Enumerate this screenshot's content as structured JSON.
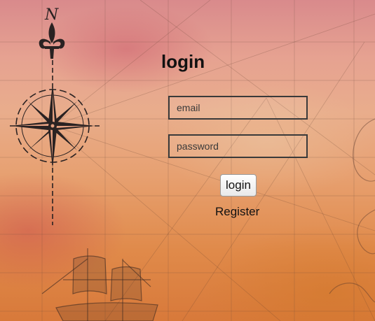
{
  "login_form": {
    "title": "login",
    "email_placeholder": "email",
    "password_placeholder": "password",
    "submit_label": "login",
    "register_label": "Register"
  },
  "background": {
    "compass_north_letter": "N",
    "colors": {
      "top": "#d98a8c",
      "middle": "#e9ad8c",
      "bottom": "#d8793a",
      "ink": "#2a2222"
    }
  }
}
